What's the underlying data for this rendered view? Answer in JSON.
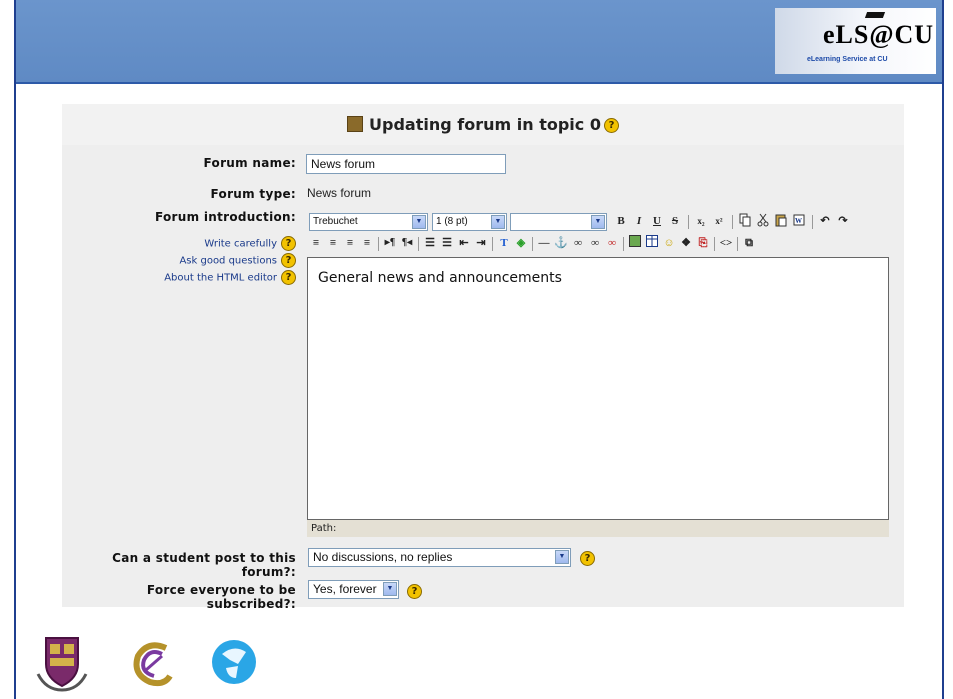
{
  "banner": {
    "logo_main": "eLS@CU",
    "logo_sub": "eLearning Service at CU"
  },
  "page": {
    "title": "Updating forum in topic 0"
  },
  "form": {
    "forum_name": {
      "label": "Forum name:",
      "value": "News forum"
    },
    "forum_type": {
      "label": "Forum type:",
      "value": "News forum"
    },
    "forum_intro": {
      "label": "Forum introduction:",
      "help_links": [
        "Write carefully",
        "Ask good questions",
        "About the HTML editor"
      ],
      "font_select": "Trebuchet",
      "size_select": "1 (8 pt)",
      "style_select": "",
      "content": "General news and announcements",
      "path_label": "Path:"
    },
    "student_post": {
      "label": "Can a student post to this forum?:",
      "value": "No discussions, no replies"
    },
    "force_subscribe": {
      "label": "Force everyone to be subscribed?:",
      "value": "Yes, forever"
    }
  },
  "toolbar": {
    "row1": [
      "B",
      "I",
      "U",
      "S",
      "x₂",
      "x²",
      "copy",
      "cut",
      "paste",
      "paste-word",
      "undo",
      "redo"
    ],
    "row2": [
      "align-left",
      "align-center",
      "align-right",
      "justify",
      "ltr",
      "rtl",
      "ordered-list",
      "unordered-list",
      "outdent",
      "indent",
      "text-color",
      "bg-color",
      "hr",
      "anchor",
      "link",
      "unlink",
      "nolink",
      "image",
      "table",
      "smiley",
      "special-char",
      "search-replace",
      "html-source",
      "fullscreen"
    ]
  },
  "help_symbol": "?",
  "colors": {
    "banner": "#5f8ac4",
    "brand_blue": "#1d4aa8",
    "help_yellow": "#f2c200"
  }
}
